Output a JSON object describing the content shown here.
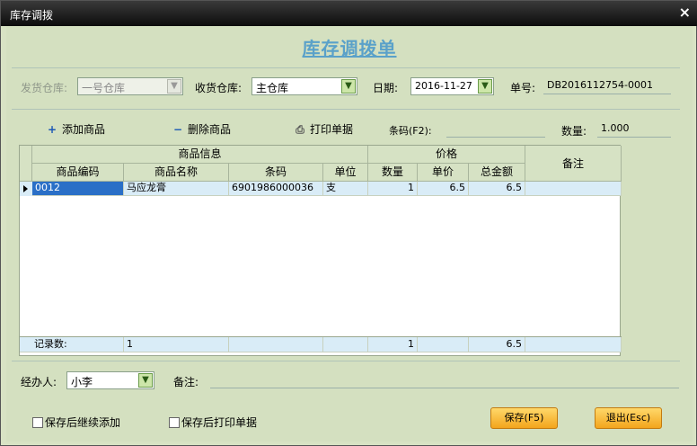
{
  "window": {
    "title": "库存调拨",
    "close": "×"
  },
  "heading": "库存调拨单",
  "form": {
    "from_label": "发货仓库:",
    "from_value": "一号仓库",
    "to_label": "收货仓库:",
    "to_value": "主仓库",
    "date_label": "日期:",
    "date_value": "2016-11-27",
    "no_label": "单号:",
    "no_value": "DB2016112754-0001"
  },
  "toolbar": {
    "add_label": "添加商品",
    "delete_label": "删除商品",
    "print_label": "打印单据",
    "barcode_label": "条码(F2):",
    "barcode_value": "",
    "qty_label": "数量:",
    "qty_value": "1.000"
  },
  "grid": {
    "groups": {
      "info": "商品信息",
      "price": "价格",
      "note": "备注"
    },
    "columns": [
      "商品编码",
      "商品名称",
      "条码",
      "单位",
      "数量",
      "单价",
      "总金额"
    ],
    "rows": [
      {
        "code": "0012",
        "name": "马应龙膏",
        "barcode": "6901986000036",
        "unit": "支",
        "qty": "1",
        "price": "6.5",
        "total": "6.5",
        "note": ""
      }
    ],
    "footer": {
      "label": "记录数:",
      "count": "1",
      "qty": "1",
      "total": "6.5"
    }
  },
  "bottom": {
    "handler_label": "经办人:",
    "handler_value": "小李",
    "remark_label": "备注:",
    "remark_value": "",
    "continue_add": "保存后继续添加",
    "print_after_save": "保存后打印单据",
    "save_button": "保存(F5)",
    "exit_button": "退出(Esc)"
  }
}
